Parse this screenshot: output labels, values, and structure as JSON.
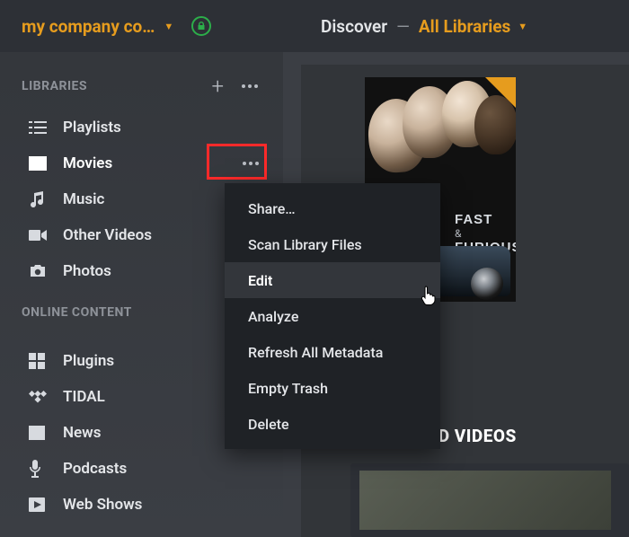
{
  "header": {
    "server_name": "my company co…",
    "discover_label": "Discover",
    "all_libraries_label": "All Libraries"
  },
  "sidebar": {
    "section1_title": "LIBRARIES",
    "section2_title": "ONLINE CONTENT",
    "libraries": [
      {
        "label": "Playlists"
      },
      {
        "label": "Movies"
      },
      {
        "label": "Music"
      },
      {
        "label": "Other Videos"
      },
      {
        "label": "Photos"
      }
    ],
    "online": [
      {
        "label": "Plugins"
      },
      {
        "label": "TIDAL"
      },
      {
        "label": "News"
      },
      {
        "label": "Podcasts"
      },
      {
        "label": "Web Shows"
      }
    ]
  },
  "context_menu": {
    "items": [
      "Share…",
      "Scan Library Files",
      "Edit",
      "Analyze",
      "Refresh All Metadata",
      "Empty Trash",
      "Delete"
    ],
    "hovered_index": 2
  },
  "poster": {
    "title_visible": "ous",
    "logo_line1": "FAST",
    "logo_amp": "&",
    "logo_line2": "FURIOUS"
  },
  "main_section_heading_visible": "Y ADDED VIDEOS"
}
